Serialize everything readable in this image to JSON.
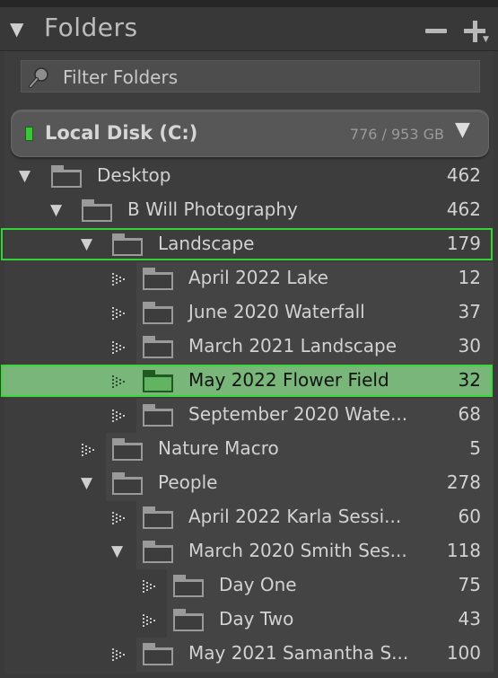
{
  "panel": {
    "title": "Folders",
    "filter_placeholder": "Filter Folders"
  },
  "disk": {
    "name": "Local Disk (C:)",
    "usage": "776 / 953 GB",
    "status_color": "#39c639"
  },
  "colors": {
    "selection_border": "#34d334",
    "selection_fill": "#79b679"
  },
  "folders": [
    {
      "label": "Desktop",
      "count": "462",
      "expanded": true
    },
    {
      "label": "B Will Photography",
      "count": "462",
      "expanded": true
    },
    {
      "label": "Landscape",
      "count": "179",
      "expanded": true,
      "selected": true
    },
    {
      "label": "April 2022 Lake",
      "count": "12"
    },
    {
      "label": "June 2020 Waterfall",
      "count": "37"
    },
    {
      "label": "March 2021 Landscape",
      "count": "30"
    },
    {
      "label": "May 2022 Flower Field",
      "count": "32",
      "active": true
    },
    {
      "label": "September 2020 Wate...",
      "count": "68"
    },
    {
      "label": "Nature Macro",
      "count": "5"
    },
    {
      "label": "People",
      "count": "278",
      "expanded": true
    },
    {
      "label": "April 2022 Karla Sessi...",
      "count": "60"
    },
    {
      "label": "March 2020 Smith Ses...",
      "count": "118",
      "expanded": true
    },
    {
      "label": "Day One",
      "count": "75"
    },
    {
      "label": "Day Two",
      "count": "43"
    },
    {
      "label": "May 2021 Samantha S...",
      "count": "100"
    }
  ]
}
